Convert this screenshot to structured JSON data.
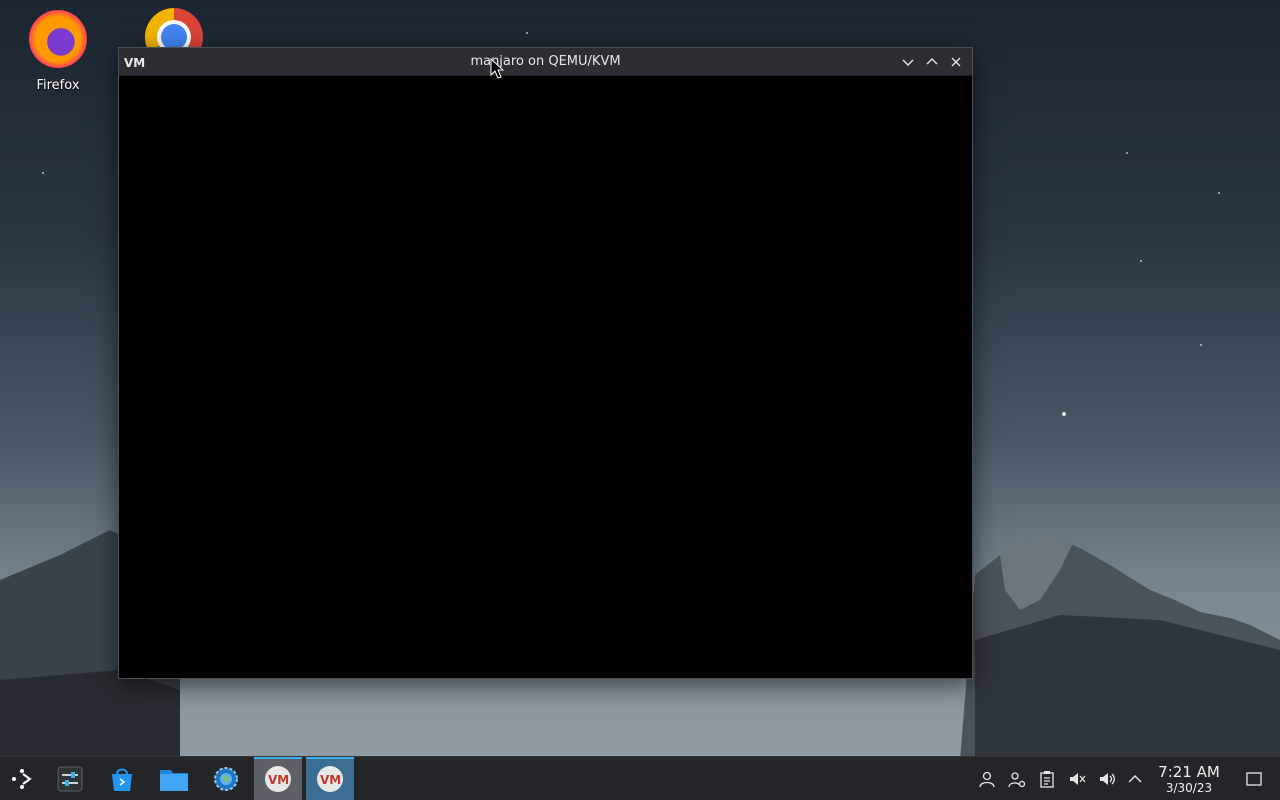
{
  "desktop": {
    "icons": [
      {
        "label": "Firefox",
        "icon": "firefox-icon"
      },
      {
        "label": "",
        "icon": "chrome-icon"
      }
    ]
  },
  "window": {
    "title": "manjaro on QEMU/KVM",
    "app_icon": "virt-manager-icon",
    "controls": [
      "minimize-icon",
      "maximize-icon",
      "close-icon"
    ]
  },
  "taskbar": {
    "launcher_icon": "application-launcher-icon",
    "pinned": [
      "system-settings-mixer-icon",
      "discover-store-icon",
      "file-manager-icon",
      "system-settings-icon"
    ],
    "tasks": [
      "virt-manager-icon",
      "virt-manager-icon"
    ],
    "tray": [
      "user-icon",
      "user-settings-icon",
      "clipboard-icon",
      "muted-speaker-icon",
      "volume-icon",
      "expand-tray-icon"
    ],
    "clock": {
      "time": "7:21 AM",
      "date": "3/30/23"
    },
    "show_desktop_icon": "show-desktop-icon"
  }
}
